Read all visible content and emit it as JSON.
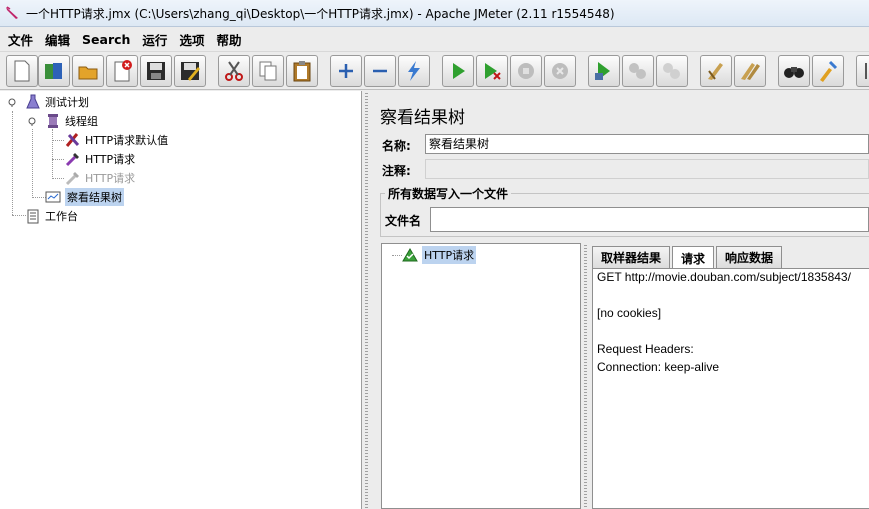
{
  "window": {
    "title": "一个HTTP请求.jmx (C:\\Users\\zhang_qi\\Desktop\\一个HTTP请求.jmx) - Apache JMeter (2.11 r1554548)"
  },
  "menu": [
    "文件",
    "编辑",
    "Search",
    "运行",
    "选项",
    "帮助"
  ],
  "toolbar": {
    "icons": [
      "new-icon",
      "templates-icon",
      "open-icon",
      "close-icon",
      "save-icon",
      "save-as-icon",
      "cut-icon",
      "copy-icon",
      "paste-icon",
      "expand-icon",
      "collapse-icon",
      "toggle-icon",
      "start-icon",
      "start-no-pauses-icon",
      "stop-icon",
      "shutdown-icon",
      "remote-start-icon",
      "remote-stop-icon",
      "remote-exit-icon",
      "clear-icon",
      "clear-all-icon",
      "search-icon",
      "reset-search-icon",
      "function-helper-icon"
    ]
  },
  "tree": {
    "test_plan": "测试计划",
    "thread_group": "线程组",
    "http_defaults": "HTTP请求默认值",
    "http_request_1": "HTTP请求",
    "http_request_2": "HTTP请求",
    "view_results_tree": "察看结果树",
    "workbench": "工作台"
  },
  "panel": {
    "title": "察看结果树",
    "name_label": "名称:",
    "name_value": "察看结果树",
    "comment_label": "注释:",
    "comment_value": "",
    "file_section_title": "所有数据写入一个文件",
    "filename_label": "文件名",
    "filename_value": ""
  },
  "results": {
    "sample_label": "HTTP请求",
    "tabs": [
      "取样器结果",
      "请求",
      "响应数据"
    ],
    "active_tab": "请求",
    "request_lines": [
      "GET http://movie.douban.com/subject/1835843/",
      "",
      "[no cookies]",
      "",
      "Request Headers:",
      "Connection: keep-alive"
    ]
  }
}
